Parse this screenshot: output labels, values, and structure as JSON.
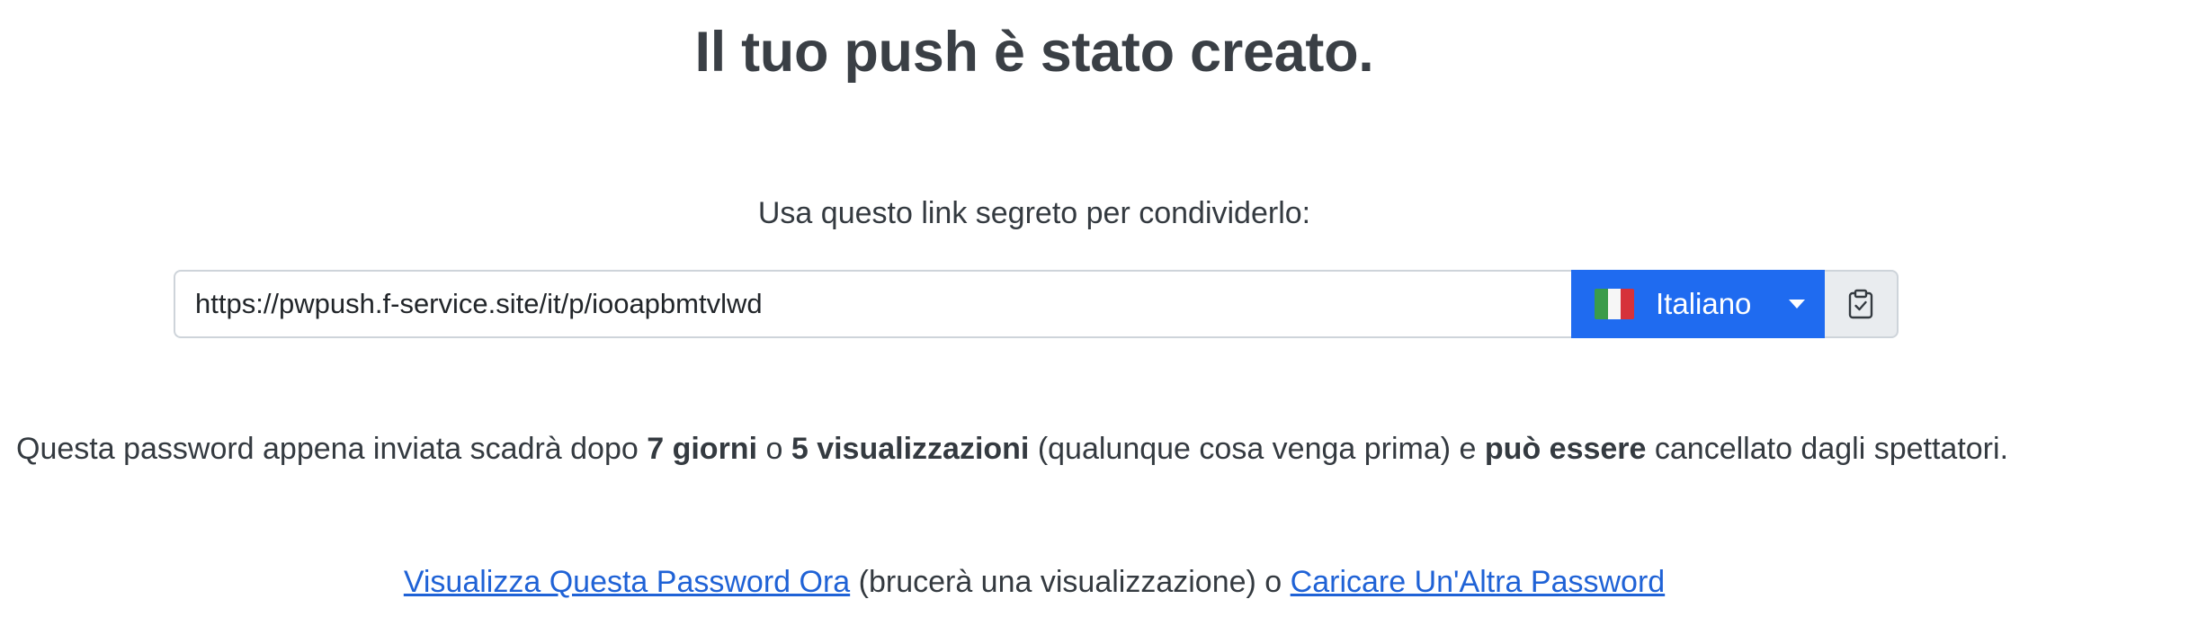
{
  "page": {
    "title": "Il tuo push è stato creato.",
    "share_label": "Usa questo link segreto per condividerlo:"
  },
  "link_group": {
    "url_value": "https://pwpush.f-service.site/it/p/iooapbmtvlwd",
    "language_label": "Italiano",
    "language_flag_icon": "italy-flag-icon",
    "copy_icon": "clipboard-check-icon",
    "accent_color": "#1f6bf0"
  },
  "expiration": {
    "part1": "Questa password appena inviata scadrà dopo ",
    "days": "7 giorni",
    "part2": " o ",
    "views": "5 visualizzazioni",
    "part3": " (qualunque cosa venga prima) e ",
    "deletable": "può essere",
    "part4": " cancellato dagli spettatori."
  },
  "actions": {
    "view_now_link": "Visualizza Questa Password Ora",
    "view_note": " (brucerà una visualizzazione) o ",
    "new_password_link": "Caricare Un'Altra Password",
    "link_color": "#1f62d6"
  }
}
